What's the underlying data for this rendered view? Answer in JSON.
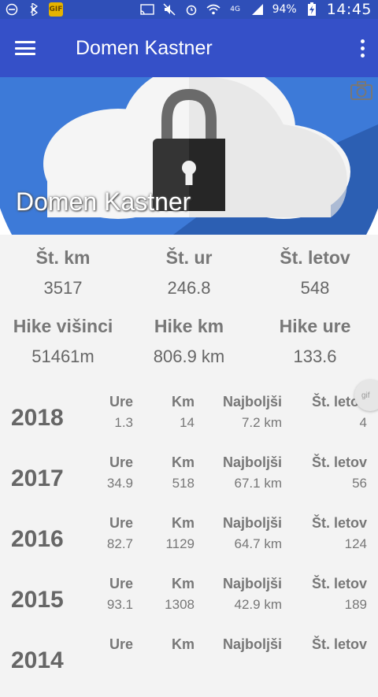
{
  "status_bar": {
    "battery_percent": "94%",
    "time": "14:45",
    "gif_label": "GIF",
    "network_label": "4G"
  },
  "app_bar": {
    "title": "Domen Kastner",
    "menu_icon": "hamburger-menu-icon",
    "overflow_icon": "more-vert-icon"
  },
  "header": {
    "name": "Domen Kastner",
    "image": "cloud-lock-image",
    "camera_icon": "camera-icon"
  },
  "totals": [
    {
      "label": "Št. km",
      "value": "3517"
    },
    {
      "label": "Št. ur",
      "value": "246.8"
    },
    {
      "label": "Št. letov",
      "value": "548"
    },
    {
      "label": "Hike višinci",
      "value": "51461m"
    },
    {
      "label": "Hike km",
      "value": "806.9 km"
    },
    {
      "label": "Hike ure",
      "value": "133.6"
    }
  ],
  "year_columns": {
    "hours": "Ure",
    "km": "Km",
    "best": "Najboljši",
    "flights": "Št. letov"
  },
  "years": [
    {
      "year": "2018",
      "hours": "1.3",
      "km": "14",
      "best": "7.2 km",
      "flights": "4"
    },
    {
      "year": "2017",
      "hours": "34.9",
      "km": "518",
      "best": "67.1 km",
      "flights": "56"
    },
    {
      "year": "2016",
      "hours": "82.7",
      "km": "1129",
      "best": "64.7 km",
      "flights": "124"
    },
    {
      "year": "2015",
      "hours": "93.1",
      "km": "1308",
      "best": "42.9 km",
      "flights": "189"
    },
    {
      "year": "2014",
      "hours": "",
      "km": "",
      "best": "",
      "flights": ""
    }
  ],
  "floating_gif_label": "gif",
  "colors": {
    "status_bar": "#2f4fb8",
    "app_bar": "#3550c8",
    "background": "#f3f3f3"
  }
}
